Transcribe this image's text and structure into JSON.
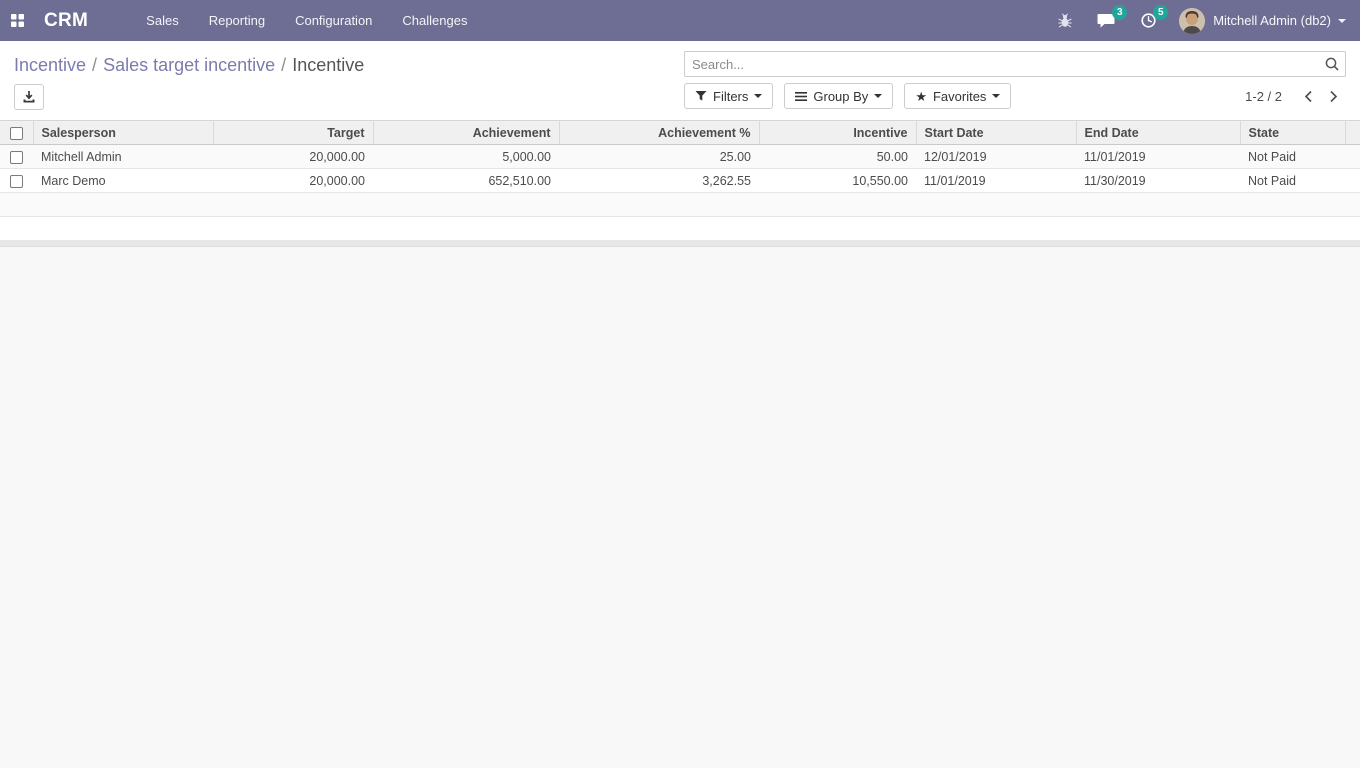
{
  "nav": {
    "brand": "CRM",
    "menu": [
      "Sales",
      "Reporting",
      "Configuration",
      "Challenges"
    ],
    "badges": {
      "messages": "3",
      "activities": "5"
    },
    "user_name": "Mitchell Admin (db2)"
  },
  "breadcrumb": {
    "separator": "/",
    "items": [
      "Incentive",
      "Sales target incentive",
      "Incentive"
    ]
  },
  "search": {
    "placeholder": "Search..."
  },
  "controls": {
    "filters_label": "Filters",
    "group_by_label": "Group By",
    "favorites_label": "Favorites"
  },
  "pager": {
    "value": "1-2 / 2"
  },
  "table": {
    "columns": [
      "Salesperson",
      "Target",
      "Achievement",
      "Achievement %",
      "Incentive",
      "Start Date",
      "End Date",
      "State"
    ],
    "rows": [
      [
        "Mitchell Admin",
        "20,000.00",
        "5,000.00",
        "25.00",
        "50.00",
        "12/01/2019",
        "11/01/2019",
        "Not Paid"
      ],
      [
        "Marc Demo",
        "20,000.00",
        "652,510.00",
        "3,262.55",
        "10,550.00",
        "11/01/2019",
        "11/30/2019",
        "Not Paid"
      ]
    ]
  },
  "colors": {
    "navbar": "#6e6d94",
    "badge": "#21a69a",
    "breadcrumb_link": "#7c7bad",
    "text": "#4c4c4c",
    "table_header_bg": "#f0f0f0",
    "row_stripe": "#fafafa"
  }
}
